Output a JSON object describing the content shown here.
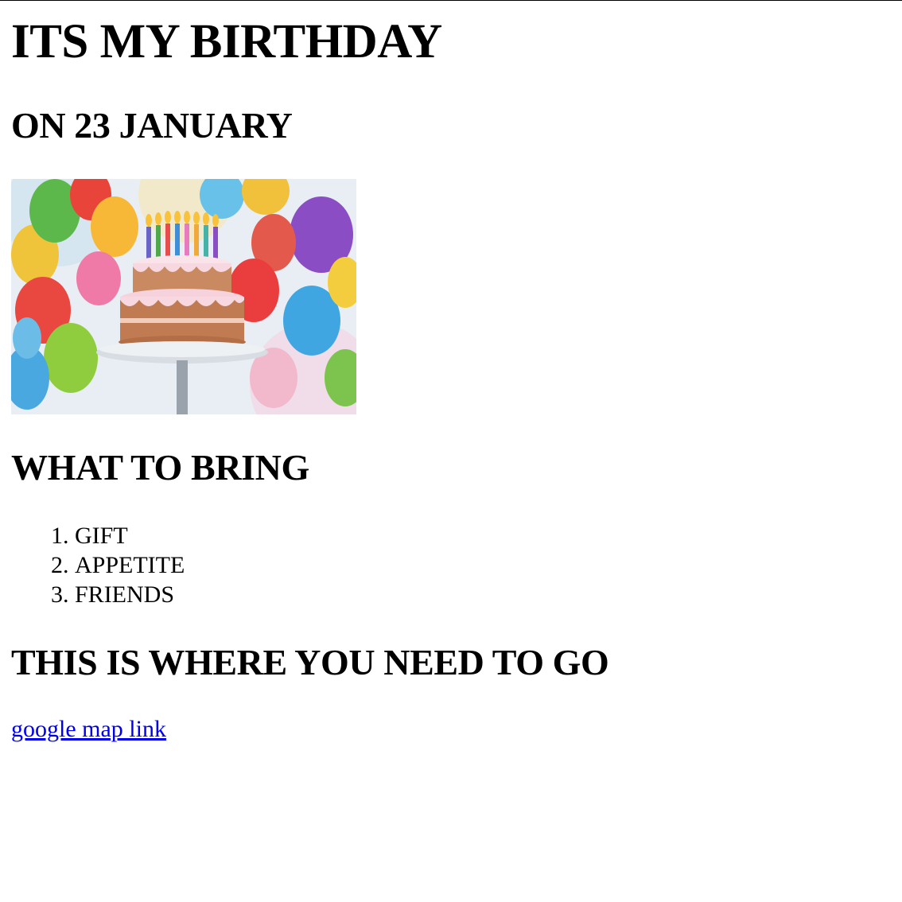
{
  "page": {
    "title": "ITS MY BIRTHDAY",
    "subtitle": "ON 23 JANUARY",
    "image": {
      "alt": "birthday cake with balloons"
    },
    "bring_heading": "WHAT TO BRING",
    "bring_items": [
      "GIFT",
      "APPETITE",
      "FRIENDS"
    ],
    "where_heading": "THIS IS WHERE YOU NEED TO GO",
    "map_link_label": "google map link"
  },
  "colors": {
    "link": "#0000ee",
    "text": "#000000",
    "background": "#ffffff"
  }
}
